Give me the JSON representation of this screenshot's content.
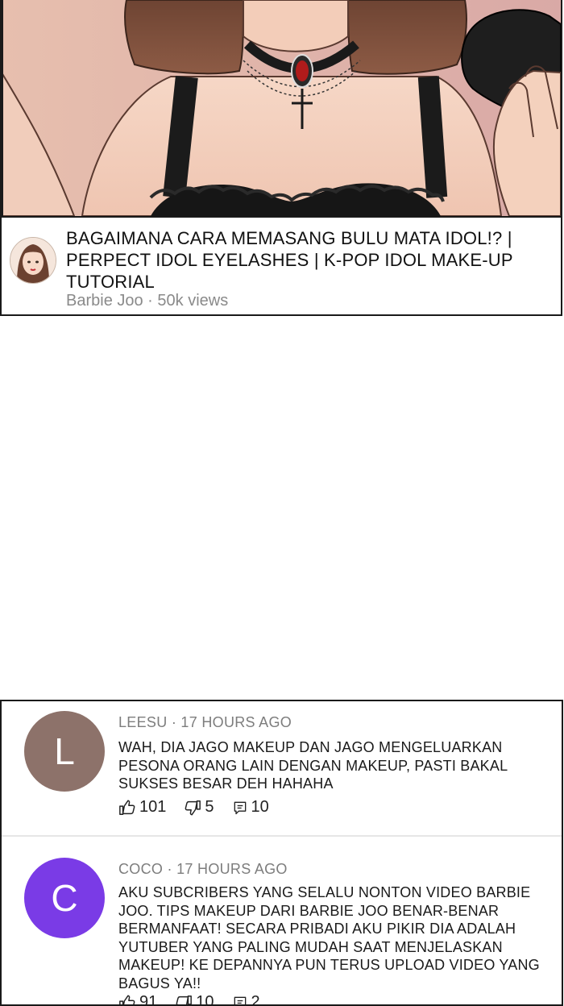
{
  "video": {
    "title": "BAGAIMANA CARA MEMASANG BULU MATA IDOL!? | PERPECT IDOL EYELASHES | K-POP IDOL MAKE-UP TUTORIAL",
    "meta": "Barbie Joo · 50k views"
  },
  "comments": [
    {
      "initial": "L",
      "avatar_color": "#8d726a",
      "author_line": "LEESU · 17 HOURS AGO",
      "text": "WAH, DIA JAGO MAKEUP DAN JAGO MENGELUARKAN PESONA ORANG LAIN DENGAN MAKEUP, PASTI BAKAL SUKSES BESAR DEH HAHAHA",
      "likes": "101",
      "dislikes": "5",
      "replies": "10"
    },
    {
      "initial": "C",
      "avatar_color": "#7a3be6",
      "author_line": "COCO · 17 HOURS AGO",
      "text": "AKU SUBCRIBERS YANG SELALU NONTON VIDEO BARBIE JOO. TIPS MAKEUP DARI BARBIE JOO BENAR-BENAR BERMANFAAT! SECARA PRIBADI AKU PIKIR DIA ADALAH YUTUBER YANG PALING MUDAH SAAT MENJELASKAN MAKEUP! KE DEPANNYA PUN TERUS UPLOAD VIDEO YANG BAGUS YA!!",
      "likes": "91",
      "dislikes": "10",
      "replies": "2"
    }
  ]
}
